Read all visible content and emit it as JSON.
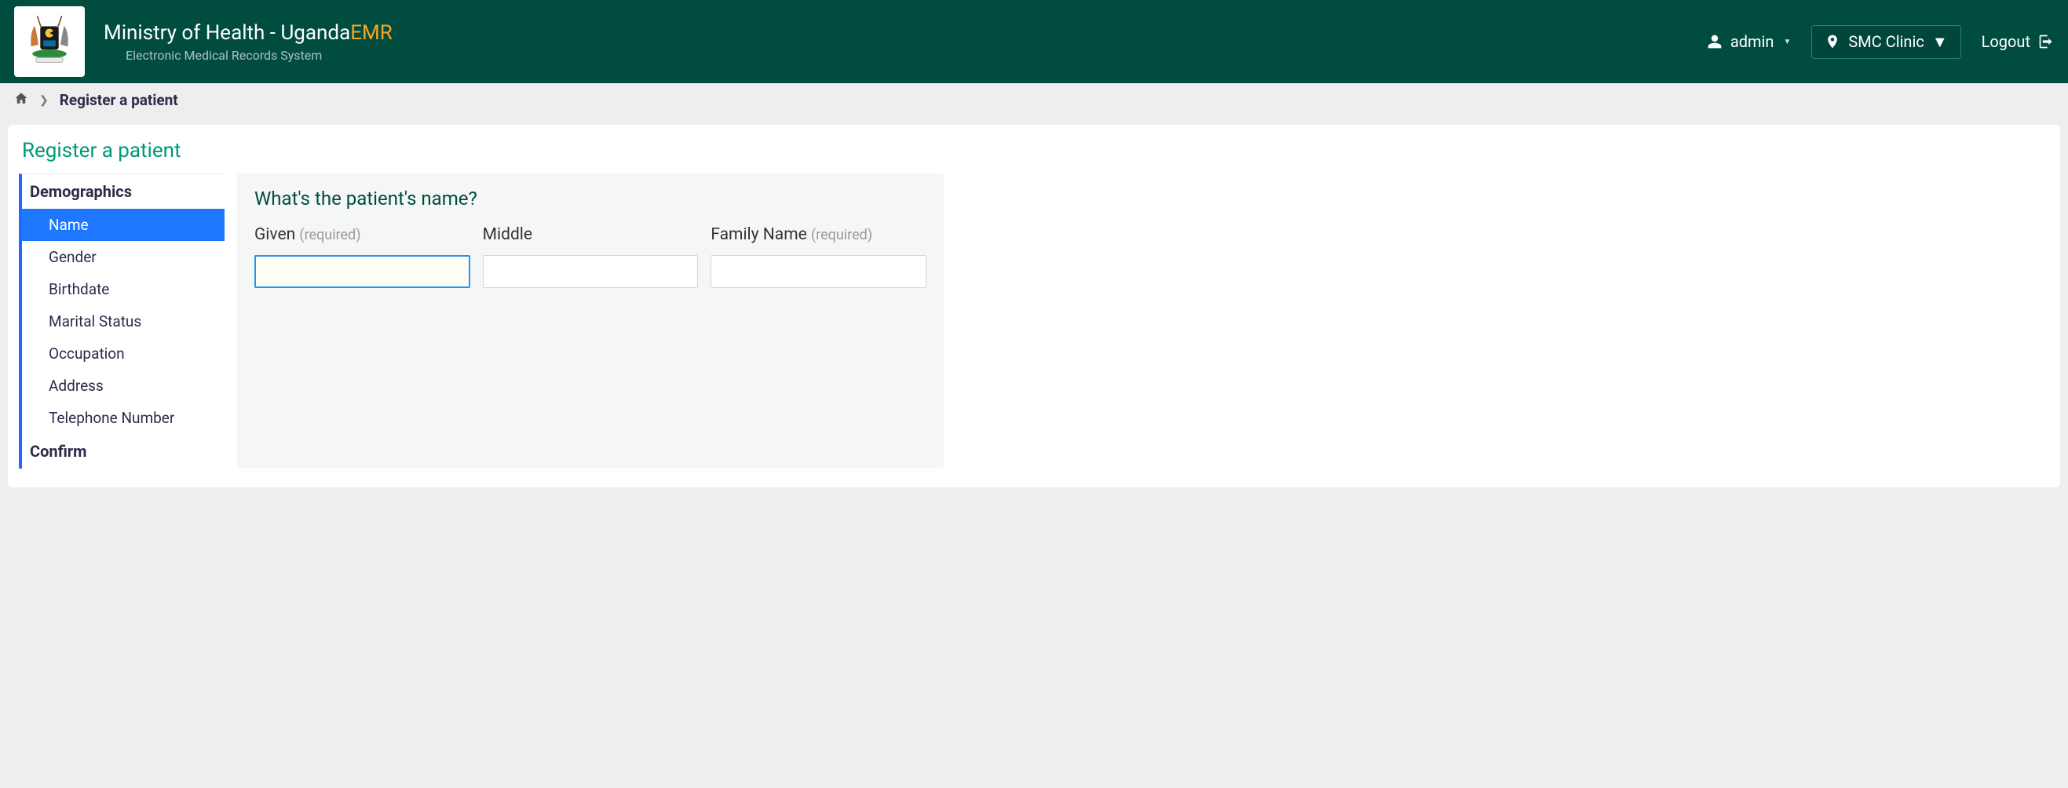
{
  "header": {
    "brand_main": "Ministry of Health - Uganda",
    "brand_emr": "EMR",
    "brand_sub": "Electronic Medical Records System",
    "user": "admin",
    "location": "SMC Clinic",
    "logout": "Logout"
  },
  "breadcrumb": {
    "current": "Register a patient"
  },
  "page": {
    "title": "Register a patient"
  },
  "sidenav": {
    "section1": "Demographics",
    "items": [
      {
        "label": "Name",
        "active": true
      },
      {
        "label": "Gender",
        "active": false
      },
      {
        "label": "Birthdate",
        "active": false
      },
      {
        "label": "Marital Status",
        "active": false
      },
      {
        "label": "Occupation",
        "active": false
      },
      {
        "label": "Address",
        "active": false
      },
      {
        "label": "Telephone Number",
        "active": false
      }
    ],
    "section2": "Confirm"
  },
  "form": {
    "question": "What's the patient's name?",
    "fields": {
      "given_label": "Given",
      "given_req": "(required)",
      "middle_label": "Middle",
      "family_label": "Family Name",
      "family_req": "(required)"
    }
  }
}
